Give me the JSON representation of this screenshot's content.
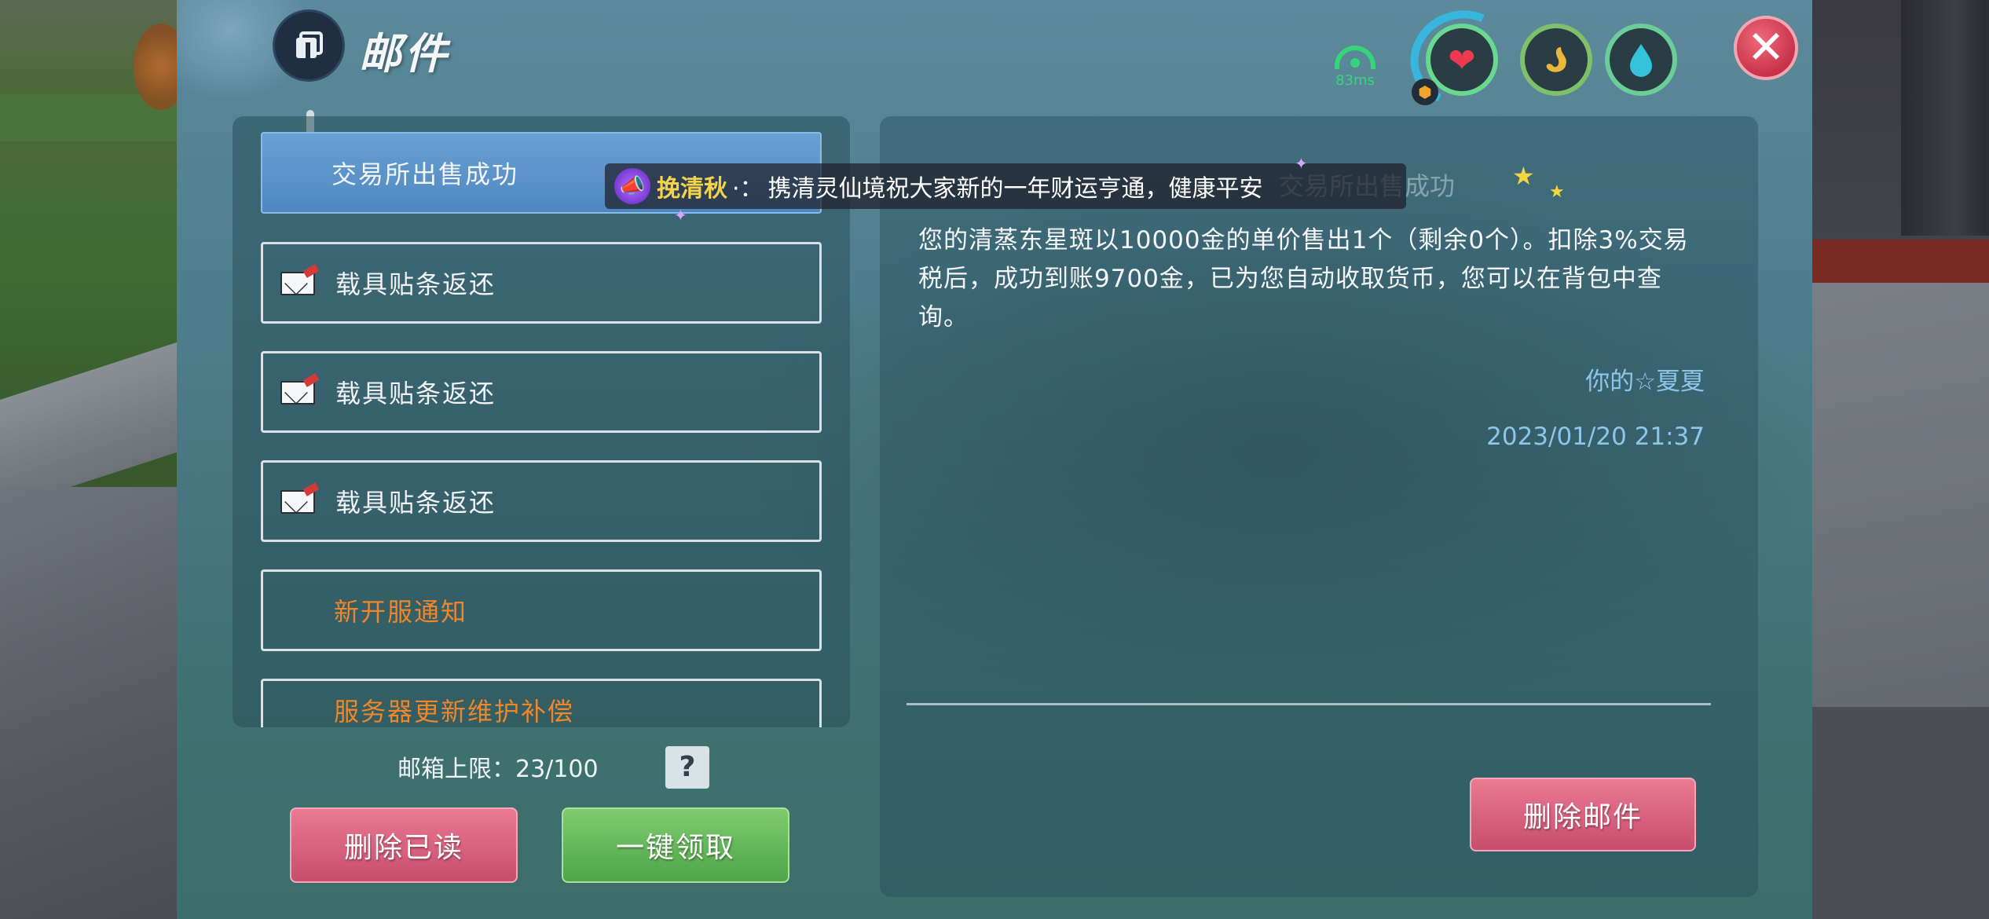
{
  "header": {
    "title": "邮件",
    "title_icon": "mailbox-icon",
    "ping": "83ms",
    "stats": [
      {
        "name": "health",
        "icon": "heart-icon",
        "color": "#ee3a50"
      },
      {
        "name": "hunger",
        "icon": "stomach-icon",
        "color": "#e9b83a"
      },
      {
        "name": "thirst",
        "icon": "water-drop-icon",
        "color": "#34c3d8"
      }
    ],
    "close_icon": "close-icon"
  },
  "mail_list": {
    "items": [
      {
        "label": "交易所出售成功",
        "selected": true,
        "icon": null,
        "color": "#f2f4f6"
      },
      {
        "label": "载具贴条返还",
        "selected": false,
        "icon": "envelope-icon",
        "color": "#f2f4f6"
      },
      {
        "label": "载具贴条返还",
        "selected": false,
        "icon": "envelope-icon",
        "color": "#f2f4f6"
      },
      {
        "label": "载具贴条返还",
        "selected": false,
        "icon": "envelope-icon",
        "color": "#f2f4f6"
      },
      {
        "label": "新开服通知",
        "selected": false,
        "icon": null,
        "color": "#f0862a"
      },
      {
        "label": "服务器更新维护补偿",
        "selected": false,
        "icon": null,
        "color": "#f0862a"
      }
    ],
    "capacity_label": "邮箱上限：23/100",
    "help_label": "?",
    "delete_read_label": "删除已读",
    "collect_all_label": "一键领取"
  },
  "detail": {
    "title": "交易所出售成功",
    "body": "您的清蒸东星斑以10000金的单价售出1个（剩余0个）。扣除3%交易税后，成功到账9700金，已为您自动收取货币，您可以在背包中查询。",
    "sender": "你的☆夏夏",
    "date": "2023/01/20 21:37",
    "delete_label": "删除邮件"
  },
  "broadcast": {
    "name": "挽清秋",
    "separator": "·：",
    "message": "携清灵仙境祝大家新的一年财运亨通，健康平安"
  },
  "colors": {
    "accent_blue": "#5b94cc",
    "pink_button": "#d45a7a",
    "green_button": "#62b45a",
    "orange_text": "#f0862a",
    "sender_blue": "#8ec6ea"
  }
}
